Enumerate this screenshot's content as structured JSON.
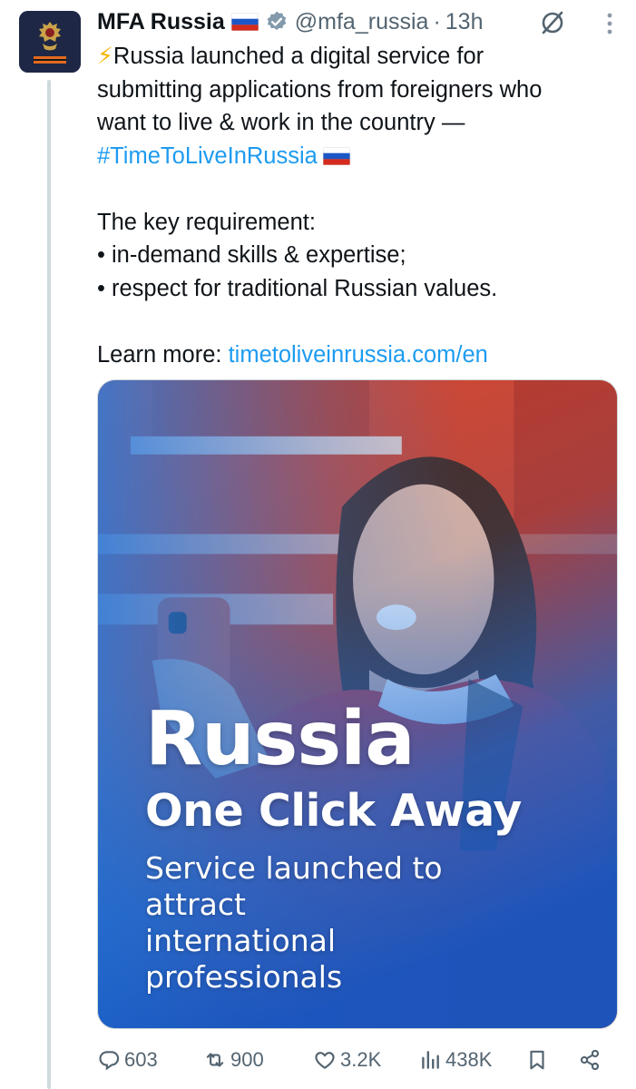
{
  "tweet": {
    "display_name": "MFA Russia",
    "handle": "@mfa_russia",
    "separator": "·",
    "time": "13h",
    "body": {
      "line1_emoji": "⚡",
      "line1": "Russia launched a digital service for",
      "line2": "submitting applications from foreigners who",
      "line3": "want to live & work in the country —",
      "hashtag": "#TimeToLiveInRussia",
      "req_heading": "The key requirement:",
      "bullet1": "• in-demand skills & expertise;",
      "bullet2": "• respect for traditional Russian values.",
      "learn_more": "Learn more: ",
      "link": "timetoliveinrussia.com/en"
    },
    "media": {
      "headline": "Russia",
      "subhead": "One Click Away",
      "caption": "Service launched to attract international professionals"
    },
    "metrics": {
      "replies": "603",
      "reposts": "900",
      "likes": "3.2K",
      "views": "438K"
    }
  },
  "colors": {
    "link": "#1d9bf0",
    "muted": "#536471",
    "text": "#0f1419",
    "verified": "#829aab"
  },
  "icons": {
    "verified": "verified-badge-icon",
    "grok": "grok-icon",
    "more": "more-vertical-icon",
    "reply": "reply-icon",
    "repost": "repost-icon",
    "like": "like-icon",
    "views": "views-icon",
    "bookmark": "bookmark-icon",
    "share": "share-icon"
  }
}
